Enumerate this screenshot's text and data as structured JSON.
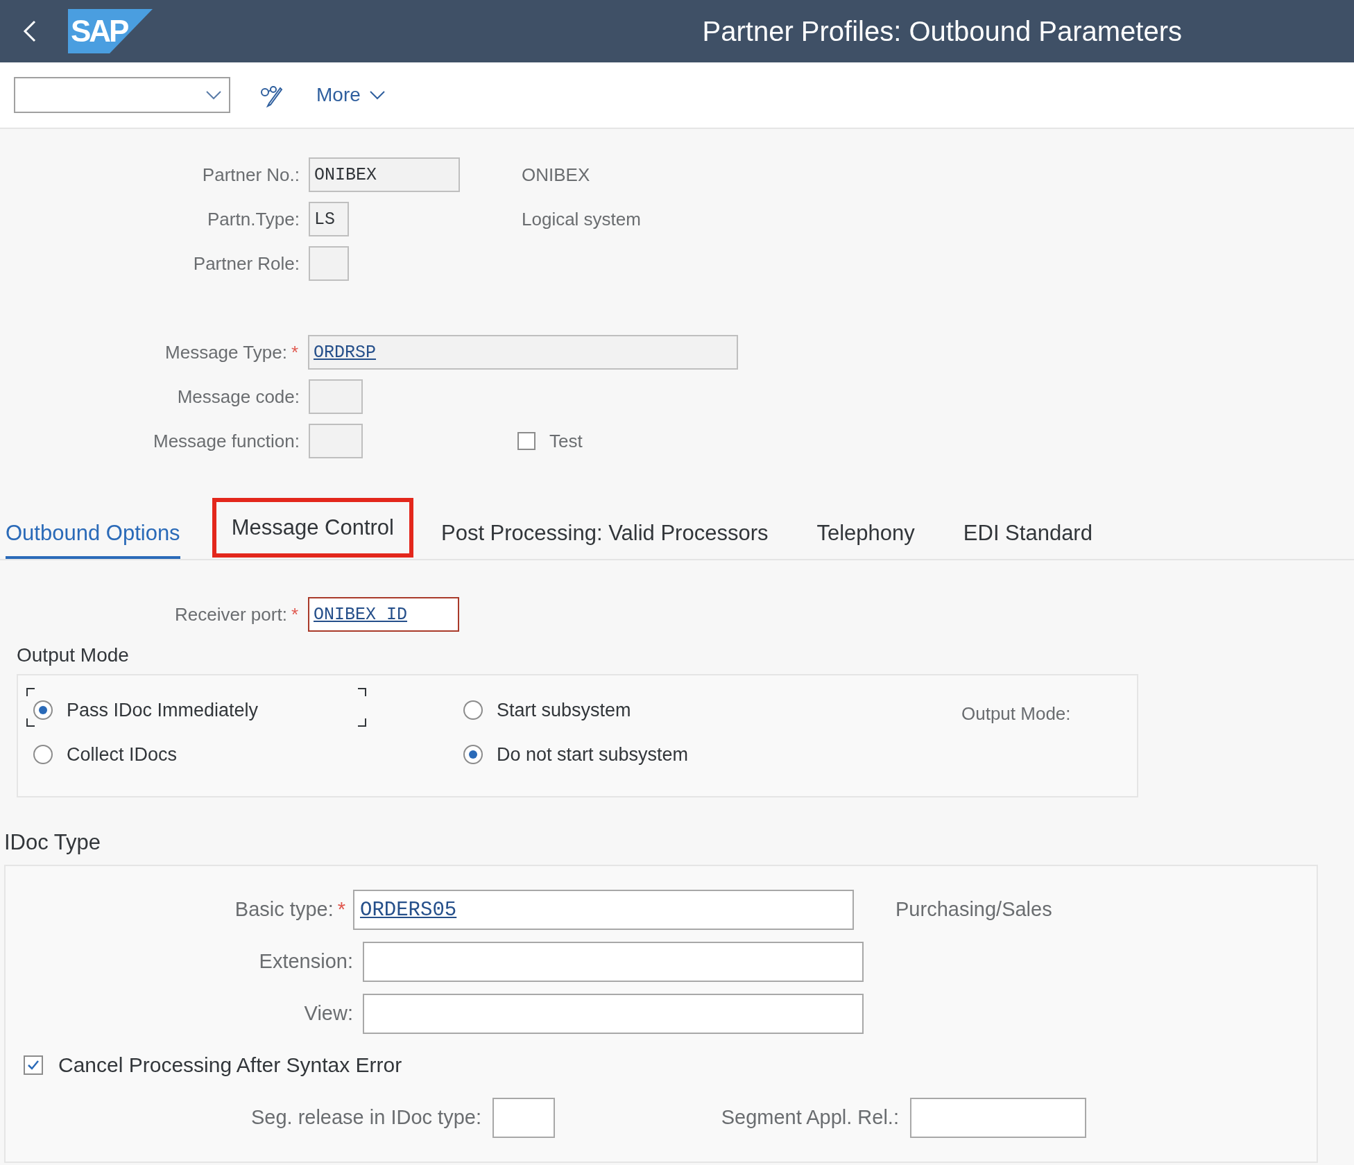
{
  "header": {
    "title": "Partner Profiles: Outbound Parameters",
    "logo_text": "SAP"
  },
  "toolbar": {
    "more_label": "More"
  },
  "partner": {
    "fields": [
      {
        "label": "Partner No.:",
        "value": "ONIBEX",
        "description": "ONIBEX"
      },
      {
        "label": "Partn.Type:",
        "value": "LS",
        "description": "Logical system"
      },
      {
        "label": "Partner Role:"
      }
    ]
  },
  "message": {
    "fields": [
      {
        "label": "Message Type:",
        "mark": "*",
        "value": "ORDRSP",
        "link": true
      },
      {
        "label": "Message code:"
      },
      {
        "label": "Message function:"
      }
    ],
    "test": {
      "label": "Test",
      "checked": false
    }
  },
  "tabs": [
    {
      "label": "Outbound Options",
      "selected": true,
      "highlighted": false
    },
    {
      "label": "Message Control",
      "selected": false,
      "highlighted": true
    },
    {
      "label": "Post Processing: Valid Processors",
      "selected": false,
      "highlighted": false
    },
    {
      "label": "Telephony",
      "selected": false,
      "highlighted": false
    },
    {
      "label": "EDI Standard",
      "selected": false,
      "highlighted": false
    }
  ],
  "outbound_options": {
    "receiver_port": {
      "label": "Receiver port:",
      "mark": "*",
      "value": "ONIBEX_ID",
      "link": true,
      "error": true
    },
    "output_mode": {
      "title": "Output Mode",
      "transfer": [
        {
          "label": "Pass IDoc Immediately",
          "selected": true,
          "focused": true
        },
        {
          "label": "Collect IDocs",
          "selected": false,
          "focused": false
        }
      ],
      "subsystem": [
        {
          "label": "Start subsystem",
          "selected": false,
          "focused": false
        },
        {
          "label": "Do not start subsystem",
          "selected": true,
          "focused": false
        }
      ],
      "output_mode_label": "Output Mode:"
    }
  },
  "idoc_type": {
    "title": "IDoc Type",
    "fields": [
      {
        "label": "Basic type:",
        "mark": "*",
        "value": "ORDERS05",
        "link": true,
        "description": "Purchasing/Sales"
      },
      {
        "label": "Extension:"
      },
      {
        "label": "View:"
      }
    ],
    "cancel_processing": {
      "label": "Cancel Processing After Syntax Error",
      "checked": true
    },
    "seg_release": {
      "label": "Seg. release in IDoc type:"
    },
    "segment_appl_rel": {
      "label": "Segment Appl. Rel.:"
    }
  }
}
